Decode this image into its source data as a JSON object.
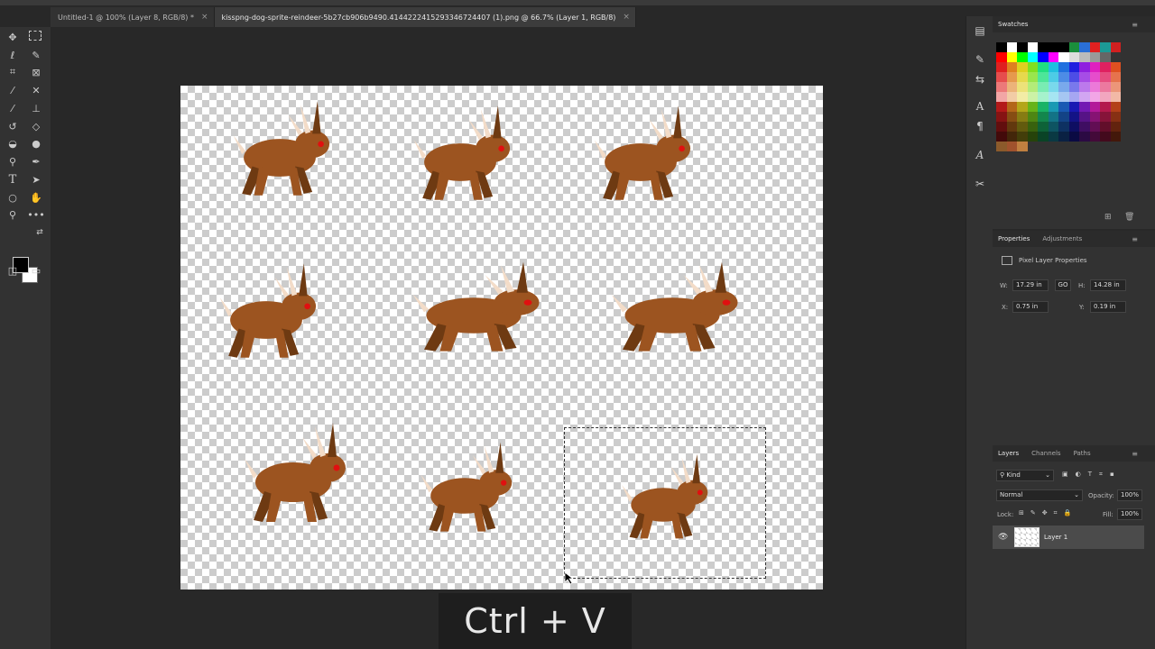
{
  "tabs": [
    {
      "label": "Untitled-1 @ 100% (Layer 8, RGB/8) *",
      "close": "×"
    },
    {
      "label": "kisspng-dog-sprite-reindeer-5b27cb906b9490.4144222415293346724407 (1).png @ 66.7% (Layer 1, RGB/8)",
      "close": "×"
    }
  ],
  "keystroke": "Ctrl + V",
  "swatches_panel": {
    "title": "Swatches"
  },
  "properties_panel": {
    "tabs": [
      "Properties",
      "Adjustments"
    ],
    "subtitle": "Pixel Layer Properties",
    "w_label": "W:",
    "w_value": "17.29 in",
    "link_label": "GO",
    "h_label": "H:",
    "h_value": "14.28 in",
    "x_label": "X:",
    "x_value": "0.75 in",
    "y_label": "Y:",
    "y_value": "0.19 in"
  },
  "layers_panel": {
    "tabs": [
      "Layers",
      "Channels",
      "Paths"
    ],
    "filter": "Kind",
    "blend_mode": "Normal",
    "opacity_label": "Opacity:",
    "opacity_value": "100%",
    "lock_label": "Lock:",
    "fill_label": "Fill:",
    "fill_value": "100%",
    "layer_name": "Layer 1"
  },
  "colors": {
    "deer_body": "#9c5420",
    "deer_dark": "#6e3a12",
    "antler": "#f3dcc8",
    "eye": "#e01010"
  },
  "icons": [
    "move-icon",
    "marquee-icon",
    "lasso-icon",
    "quick-select-icon",
    "crop-icon",
    "frame-icon",
    "eyedropper-icon",
    "healing-icon",
    "brush-icon",
    "stamp-icon",
    "history-brush-icon",
    "eraser-icon",
    "bucket-icon",
    "blur-icon",
    "dodge-icon",
    "pen-icon",
    "type-icon",
    "path-select-icon",
    "shape-icon",
    "hand-icon",
    "zoom-icon",
    "more-icon"
  ]
}
